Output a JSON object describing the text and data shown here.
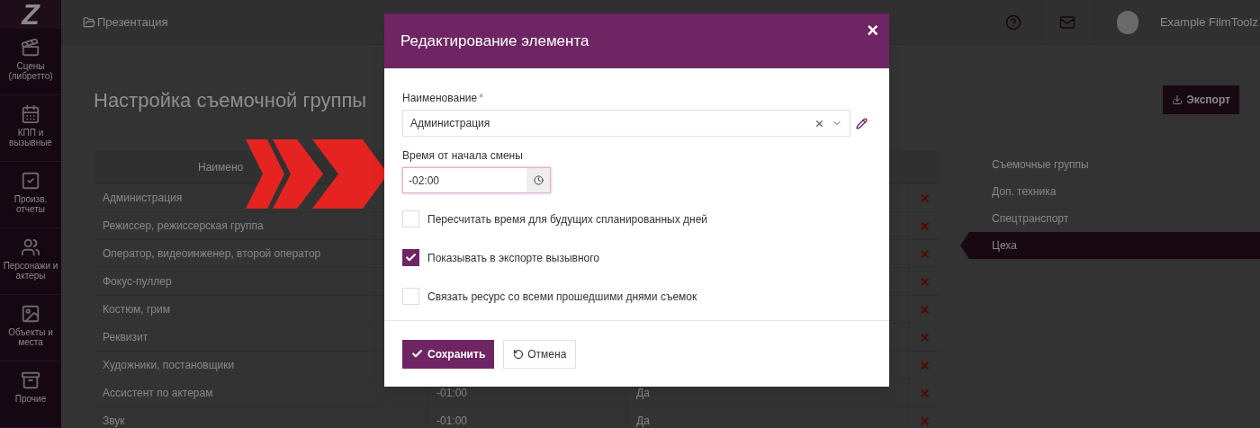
{
  "logo": "Z",
  "sidebar": {
    "items": [
      {
        "label": "Сцены (либретто)"
      },
      {
        "label": "КПП и вызывные"
      },
      {
        "label": "Произв. отчеты"
      },
      {
        "label": "Персонажи и актеры"
      },
      {
        "label": "Объекты и места"
      },
      {
        "label": "Прочие"
      }
    ]
  },
  "topbar": {
    "breadcrumb": "Презентация",
    "user": "Example FilmToolz"
  },
  "page": {
    "title": "Настройка съемочной группы",
    "export_button": "Экспорт"
  },
  "table": {
    "columns": [
      "Наимено"
    ],
    "rows": [
      {
        "name": "Администрация"
      },
      {
        "name": "Режиссер, режиссерская группа"
      },
      {
        "name": "Оператор, видеоинженер, второй оператор"
      },
      {
        "name": "Фокус-пуллер"
      },
      {
        "name": "Костюм, грим"
      },
      {
        "name": "Реквизит"
      },
      {
        "name": "Художники, постановщики"
      },
      {
        "name": "Ассистент по актерам",
        "time": "-01:00",
        "flag": "Да"
      },
      {
        "name": "Звук",
        "time": "-01:00",
        "flag": "Да"
      }
    ]
  },
  "right_menu": [
    {
      "label": "Съемочные группы",
      "selected": false
    },
    {
      "label": "Доп. техника",
      "selected": false
    },
    {
      "label": "Спецтранспорт",
      "selected": false
    },
    {
      "label": "Цеха",
      "selected": true
    }
  ],
  "dialog": {
    "title": "Редактирование элемента",
    "close": "×",
    "name_label": "Наименование",
    "required_mark": "*",
    "name_value": "Администрация",
    "time_label": "Время от начала смены",
    "time_value": "-02:00",
    "checkboxes": [
      {
        "label": "Пересчитать время для будущих спланированных дней",
        "checked": false
      },
      {
        "label": "Показывать в экспорте вызывного",
        "checked": true
      },
      {
        "label": "Связать ресурс со всеми прошедшими днями съемок",
        "checked": false
      }
    ],
    "save_button": "Сохранить",
    "cancel_button": "Отмена"
  }
}
